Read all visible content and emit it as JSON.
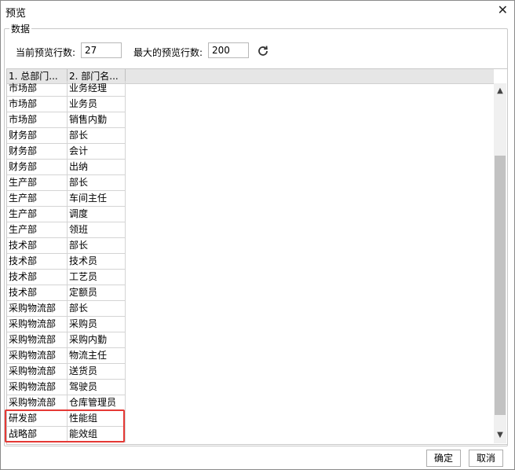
{
  "window": {
    "title": "预览"
  },
  "group": {
    "label": "数据"
  },
  "settings": {
    "current_rows_label": "当前预览行数:",
    "current_rows_value": "27",
    "max_rows_label": "最大的预览行数:",
    "max_rows_value": "200"
  },
  "grid": {
    "columns": [
      "1. 总部门...",
      "2. 部门名..."
    ],
    "rows": [
      [
        "市场部",
        "业务经理"
      ],
      [
        "市场部",
        "业务员"
      ],
      [
        "市场部",
        "销售内勤"
      ],
      [
        "财务部",
        "部长"
      ],
      [
        "财务部",
        "会计"
      ],
      [
        "财务部",
        "出纳"
      ],
      [
        "生产部",
        "部长"
      ],
      [
        "生产部",
        "车间主任"
      ],
      [
        "生产部",
        "调度"
      ],
      [
        "生产部",
        "领班"
      ],
      [
        "技术部",
        "部长"
      ],
      [
        "技术部",
        "技术员"
      ],
      [
        "技术部",
        "工艺员"
      ],
      [
        "技术部",
        "定额员"
      ],
      [
        "采购物流部",
        "部长"
      ],
      [
        "采购物流部",
        "采购员"
      ],
      [
        "采购物流部",
        "采购内勤"
      ],
      [
        "采购物流部",
        "物流主任"
      ],
      [
        "采购物流部",
        "送货员"
      ],
      [
        "采购物流部",
        "驾驶员"
      ],
      [
        "采购物流部",
        "仓库管理员"
      ],
      [
        "研发部",
        "性能组"
      ],
      [
        "战略部",
        "能效组"
      ]
    ]
  },
  "buttons": {
    "ok": "确定",
    "cancel": "取消"
  },
  "icons": {
    "close": "close-icon",
    "refresh": "refresh-icon",
    "scroll_up": "chevron-up-icon",
    "scroll_down": "chevron-down-icon"
  },
  "colors": {
    "highlight": "#e53935",
    "header_bg": "#e6e6e6"
  }
}
